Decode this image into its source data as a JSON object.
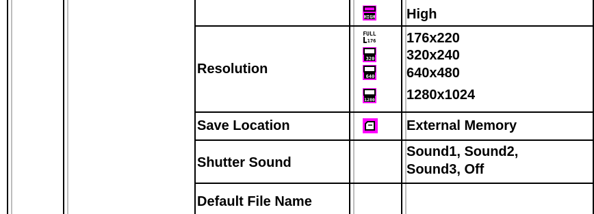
{
  "table": {
    "quality_value": "High",
    "resolution_label": "Resolution",
    "resolution_values": [
      "176x220",
      "320x240",
      "640x480",
      "1280x1024"
    ],
    "save_location_label": "Save Location",
    "save_location_value": "External Memory",
    "shutter_sound_label": "Shutter Sound",
    "shutter_sound_line1": "Sound1, Sound2,",
    "shutter_sound_line2": "Sound3, Off",
    "default_file_name_label": "Default File Name",
    "icons": {
      "quality_high": "HIGH",
      "res_full": "FULL 176",
      "res_320": "320",
      "res_640": "640",
      "res_1280": "1280",
      "save_location": "memory-card-icon"
    },
    "colors": {
      "icon_bg": "#ff00ff",
      "border": "#000000",
      "border_gray": "#bdbdbd"
    }
  }
}
